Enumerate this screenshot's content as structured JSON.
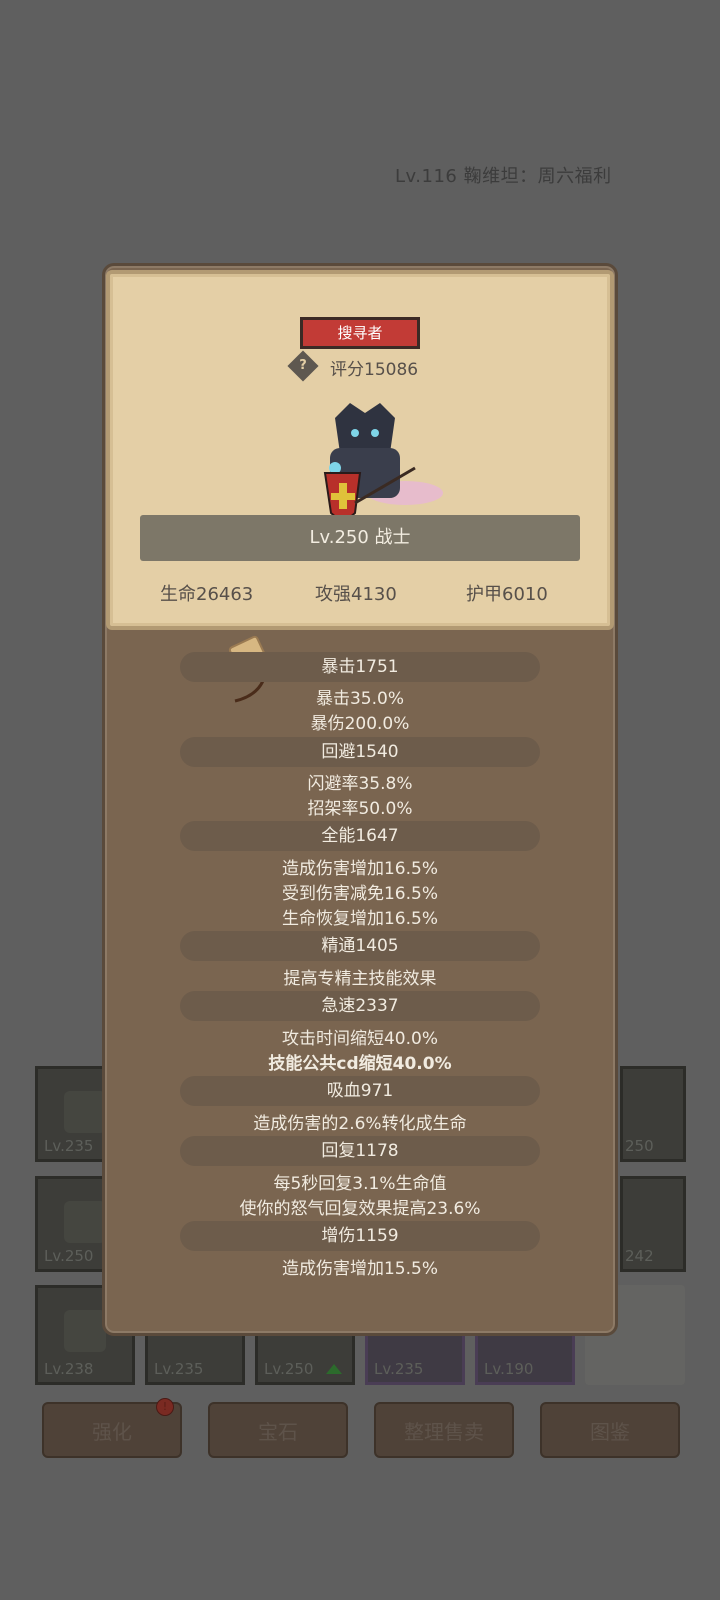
{
  "background": {
    "title": "Lv.116 鞠维坦：周六福利",
    "slots": [
      {
        "level": "Lv.235"
      },
      {
        "level": "250"
      },
      {
        "level": "Lv.250"
      },
      {
        "level": "242"
      },
      {
        "level": "Lv.238"
      },
      {
        "level": "Lv.235"
      },
      {
        "level": "Lv.250"
      },
      {
        "level": "Lv.235"
      },
      {
        "level": "Lv.190"
      }
    ],
    "buttons": {
      "strengthen": "强化",
      "gem": "宝石",
      "sort_sell": "整理售卖",
      "codex": "图鉴"
    },
    "badge": "!"
  },
  "popup": {
    "class_tag": "搜寻者",
    "help_icon": "?",
    "score": "评分15086",
    "level_class": "Lv.250 战士",
    "top_stats": {
      "hp": "生命26463",
      "atk": "攻强4130",
      "armor": "护甲6010"
    },
    "stats": [
      {
        "header": "暴击1751",
        "lines": [
          "暴击35.0%",
          "暴伤200.0%"
        ]
      },
      {
        "header": "回避1540",
        "lines": [
          "闪避率35.8%",
          "招架率50.0%"
        ]
      },
      {
        "header": "全能1647",
        "lines": [
          "造成伤害增加16.5%",
          "受到伤害减免16.5%",
          "生命恢复增加16.5%"
        ]
      },
      {
        "header": "精通1405",
        "lines": [
          "提高专精主技能效果"
        ]
      },
      {
        "header": "急速2337",
        "lines": [
          "攻击时间缩短40.0%",
          "技能公共cd缩短40.0%"
        ]
      },
      {
        "header": "吸血971",
        "lines": [
          "造成伤害的2.6%转化成生命"
        ]
      },
      {
        "header": "回复1178",
        "lines": [
          "每5秒回复3.1%生命值",
          "使你的怒气回复效果提高23.6%"
        ]
      },
      {
        "header": "增伤1159",
        "lines": [
          "造成伤害增加15.5%"
        ]
      }
    ]
  }
}
